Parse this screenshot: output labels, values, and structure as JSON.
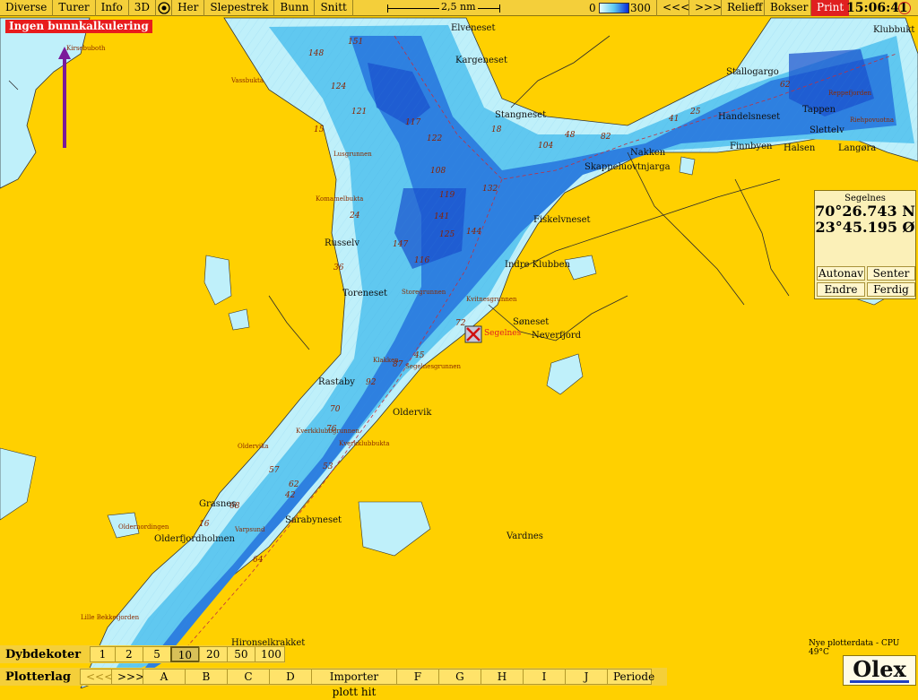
{
  "toolbar": {
    "items": [
      "Diverse",
      "Turer",
      "Info",
      "3D"
    ],
    "her": "Her",
    "items2": [
      "Slepestrek",
      "Bunn",
      "Snitt"
    ],
    "scale_label": "2,5 nm",
    "depth_min": "0",
    "depth_max": "300",
    "prev": "<<<",
    "next": ">>>",
    "relief": "Relieff",
    "bokser": "Bokser",
    "print": "Print",
    "clock": "15:06:41"
  },
  "warning": "Ingen bunnkalkulering",
  "position": {
    "name": "Segelnes",
    "lat": "70°26.743 N",
    "lon": "23°45.195 Ø",
    "buttons": [
      "Autonav",
      "Senter",
      "Endre",
      "Ferdig"
    ]
  },
  "depth_contours": {
    "label": "Dybdekoter",
    "values": [
      "1",
      "2",
      "5",
      "10",
      "20",
      "50",
      "100"
    ],
    "selected": "10"
  },
  "plot_layers": {
    "label": "Plotterlag",
    "prev": "<<<",
    "next": ">>>",
    "layers": [
      "A",
      "B",
      "C",
      "D"
    ],
    "import": "Importer plott hit",
    "layers2": [
      "F",
      "G",
      "H",
      "I",
      "J"
    ],
    "period": "Periode"
  },
  "status": "Nye plotterdata - CPU 49°C",
  "brand": "Olex",
  "place_names": {
    "elveneset": "Elveneset",
    "kargeneset": "Kargeneset",
    "stangneset": "Stangneset",
    "stallogargo": "Stallogargo",
    "klubbukt": "Klubbukt",
    "tappen": "Tappen",
    "handelsneset": "Handelsneset",
    "sletteiv": "Slettelv",
    "langora": "Langøra",
    "finnbyen": "Finnbyen",
    "halsen": "Halsen",
    "nakken": "Nakken",
    "skappel": "Skappeluovtnjarga",
    "fiskelvneset": "Fiskelvneset",
    "indre_klubben": "Indre Klubben",
    "russelv": "Russelv",
    "toreneset": "Toreneset",
    "soneset": "Søneset",
    "segelnes": "Segelnes",
    "neverfjord": "Neverfjord",
    "rastaby": "Rastaby",
    "oldervik": "Oldervik",
    "grasnes": "Grasnes",
    "sarabyneset": "Sarabyneset",
    "olderfjordholmen": "Olderfjordholmen",
    "vardnes": "Vardnes",
    "hironselkrakket": "Hironselkrakket",
    "vassbukta": "Vassbukta",
    "komamelbukta": "Komamelbukta",
    "lusgrunnen": "Lusgrunnen",
    "storegrunnen": "Storegrunnen",
    "kvitnesgrunnen": "Kvitnesgrunnen",
    "klakken": "Klakken",
    "segelnesgrunnen": "Segelnesgrunnen",
    "kverkklubbgrunnen": "Kverkklubbgrunnen",
    "kverkklubbukta": "Kverkklubbukta",
    "oldervika": "Oldervika",
    "varpsund": "Varpsund",
    "oldernordingen": "Oldernordingen",
    "lille_bekkefjorden": "Lille Bekkefjorden",
    "reppefjorden": "Reppefjorden",
    "riehpovuotna": "Riehpovuotna",
    "kirsebuboth": "Kirsebuboth"
  },
  "soundings": [
    "148",
    "151",
    "124",
    "121",
    "117",
    "108",
    "116",
    "119",
    "141",
    "125",
    "147",
    "144",
    "132",
    "122",
    "104",
    "92",
    "87",
    "76",
    "70",
    "57",
    "45",
    "36",
    "24",
    "16",
    "68",
    "42",
    "53",
    "72",
    "82",
    "48",
    "64",
    "62",
    "41",
    "25",
    "18",
    "15",
    "62"
  ],
  "colors": {
    "land": "#ffd000",
    "shallow": "#bff0fa",
    "mid": "#60c8f0",
    "deep": "#1e60d8",
    "toolbar": "#f4cf3a",
    "warning": "#e81c1c"
  }
}
